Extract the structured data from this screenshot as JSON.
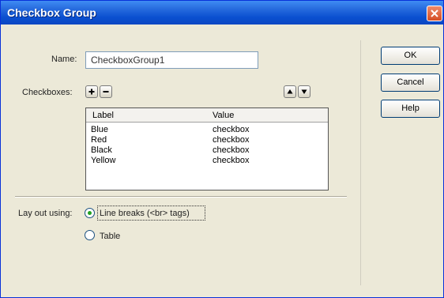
{
  "dialog": {
    "title": "Checkbox Group"
  },
  "form": {
    "name_label": "Name:",
    "name_value": "CheckboxGroup1",
    "checkboxes_label": "Checkboxes:",
    "columns": [
      "Label",
      "Value"
    ],
    "rows": [
      {
        "label": "Blue",
        "value": "checkbox"
      },
      {
        "label": "Red",
        "value": "checkbox"
      },
      {
        "label": "Black",
        "value": "checkbox"
      },
      {
        "label": "Yellow",
        "value": "checkbox"
      }
    ],
    "layout_label": "Lay out using:",
    "layout_options": [
      {
        "label": "Line breaks (<br> tags)",
        "selected": true
      },
      {
        "label": "Table",
        "selected": false
      }
    ]
  },
  "buttons": {
    "ok": "OK",
    "cancel": "Cancel",
    "help": "Help"
  },
  "icons": {
    "add": "plus-icon",
    "remove": "minus-icon",
    "up": "arrow-up-icon",
    "down": "arrow-down-icon",
    "close": "close-icon"
  }
}
